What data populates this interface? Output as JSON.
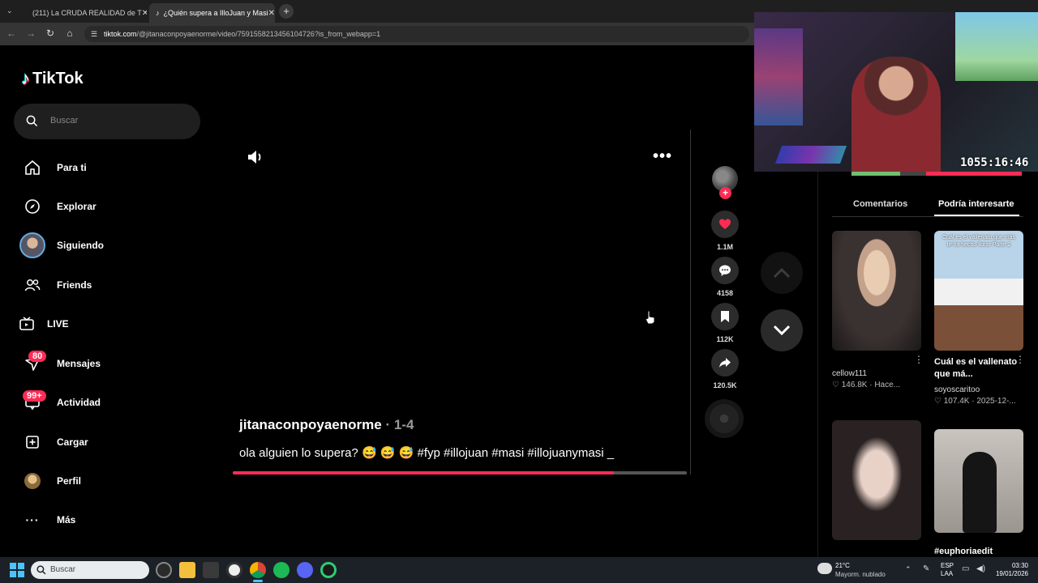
{
  "browser": {
    "tabs": [
      {
        "title": "(211) La CRUDA REALIDAD de T",
        "active": false
      },
      {
        "title": "¿Quién supera a IlloJuan y Masi",
        "active": true
      }
    ],
    "url_domain": "tiktok.com",
    "url_path": "/@jitanaconpoyaenorme/video/7591558213456104726?is_from_webapp=1"
  },
  "sidebar": {
    "logo": "TikTok",
    "search_placeholder": "Buscar",
    "items": [
      {
        "label": "Para ti",
        "icon": "home-icon"
      },
      {
        "label": "Explorar",
        "icon": "compass-icon"
      },
      {
        "label": "Siguiendo",
        "icon": "avatar"
      },
      {
        "label": "Friends",
        "icon": "friends-icon"
      },
      {
        "label": "LIVE",
        "icon": "live-icon"
      },
      {
        "label": "Mensajes",
        "icon": "message-icon",
        "badge": "80"
      },
      {
        "label": "Actividad",
        "icon": "activity-icon",
        "badge": "99+"
      },
      {
        "label": "Cargar",
        "icon": "upload-icon"
      },
      {
        "label": "Perfil",
        "icon": "profile-avatar"
      },
      {
        "label": "Más",
        "icon": "more-icon"
      }
    ]
  },
  "video": {
    "author": "jitanaconpoyaenorme",
    "date": "· 1-4",
    "caption": "ola alguien lo supera? 😅 😅 😅 #fyp #illojuan #masi #illojuanymasi _",
    "progress": 0.84,
    "actions": {
      "likes": "1.1M",
      "comments": "4158",
      "saves": "112K",
      "shares": "120.5K"
    }
  },
  "stream_overlay": {
    "timer": "1055:16:46"
  },
  "right_panel": {
    "tabs": [
      "Comentarios",
      "Podría interesarte"
    ],
    "active_tab": 1,
    "recommendations": [
      {
        "title": "",
        "author": "cellow111",
        "stats": "♡ 146.8K · Hace..."
      },
      {
        "title": "Cuál es el vallenato que má...",
        "author": "soyoscaritoo",
        "stats": "♡ 107.4K · 2025-12-..."
      },
      {
        "title": "",
        "author": "",
        "stats": ""
      },
      {
        "title": "#euphoriaedit",
        "author": "",
        "stats": ""
      }
    ],
    "thumb_overlay_text": "Cuál es el vallenato que más te ha hecho llorar Parte 2"
  },
  "taskbar": {
    "search_placeholder": "Buscar",
    "weather_temp": "21°C",
    "weather_desc": "Mayorm. nublado",
    "lang": "ESP",
    "lang_sub": "LAA",
    "time": "03:30",
    "date": "19/01/2026"
  },
  "colors": {
    "accent": "#fe2c55",
    "background": "#000000",
    "taskbar": "#1c2128"
  }
}
